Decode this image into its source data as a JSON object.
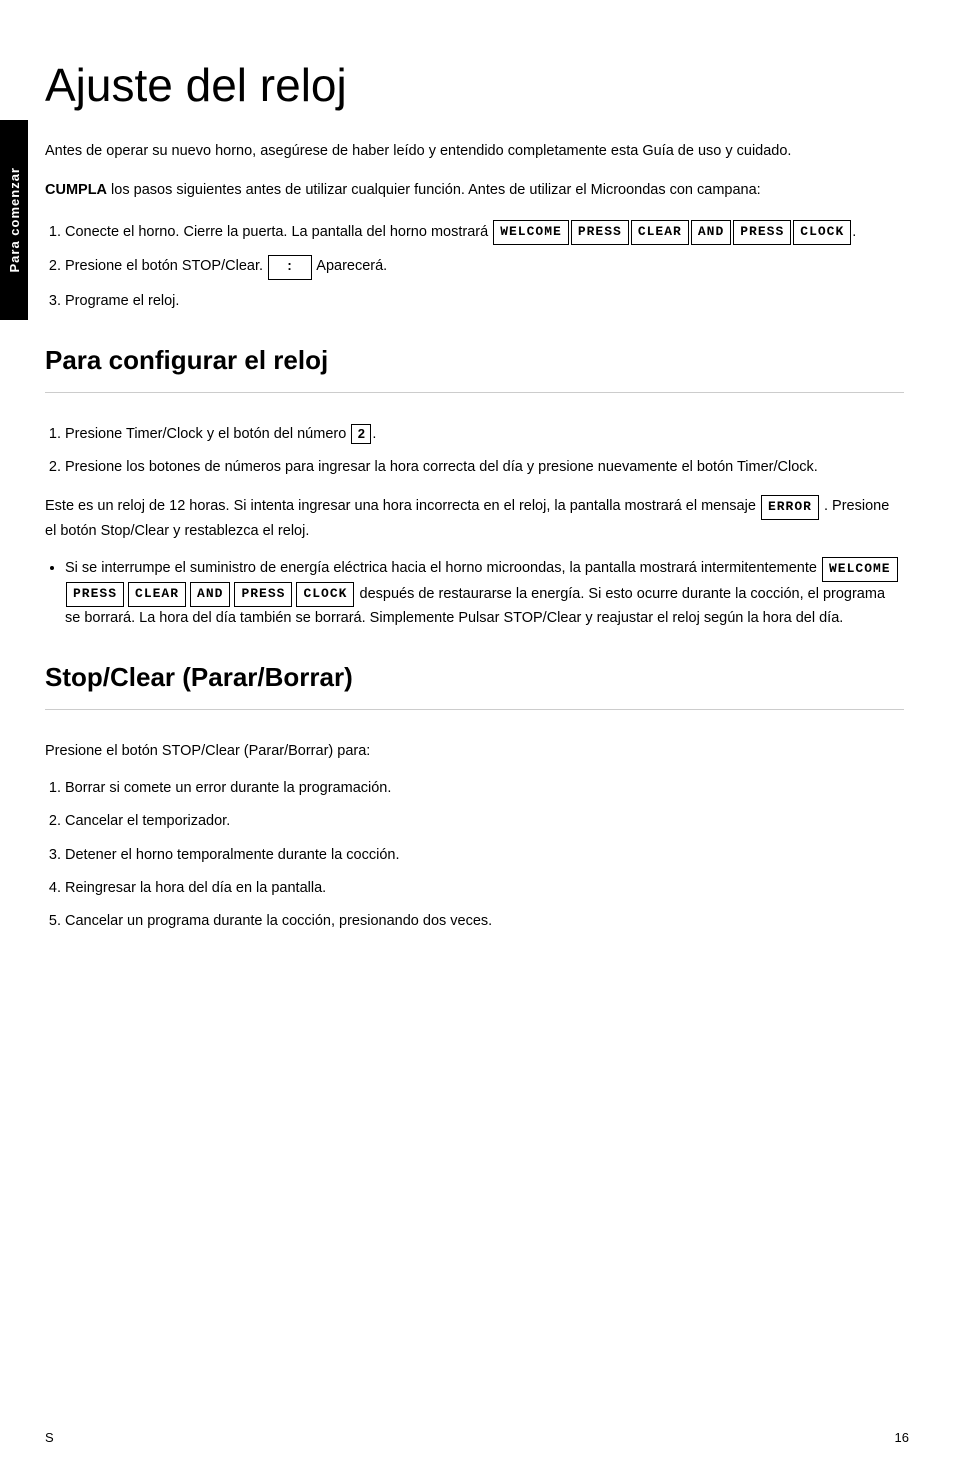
{
  "sidebar": {
    "label": "Para comenzar"
  },
  "page": {
    "title": "Ajuste del reloj",
    "footer_left": "S",
    "footer_center": "16"
  },
  "intro": {
    "paragraph1": "Antes de operar su nuevo horno, asegúrese de haber leído y entendido completamente esta Guía de uso y cuidado.",
    "bold": "CUMPLA",
    "paragraph2": " los pasos siguientes antes de utilizar cualquier función. Antes de utilizar el Microondas con campana:"
  },
  "steps": {
    "step1_prefix": "Conecte el horno. Cierre la puerta. La pantalla del horno mostrará ",
    "step1_suffix": ".",
    "step2_prefix": "Presione el botón STOP/Clear.",
    "step2_suffix": "Aparecerá.",
    "step3": "Programe el reloj."
  },
  "lcd_labels": {
    "welcome": "WELCOME",
    "press1": "PRESS",
    "clear": "CLEAR",
    "and": "AND",
    "press2": "PRESS",
    "clock": "CLOCK",
    "time": "  :  ",
    "error": "ERROR",
    "press_a": "PRESS",
    "clear_b": "CLEAR",
    "and_b": "AND",
    "press_b": "PRESS",
    "clock_b": "CLOCK"
  },
  "section_configurar": {
    "title": "Para configurar el reloj",
    "item1": "Presione Timer/Clock y el botón del número ",
    "item2": "Presione los botones de números para ingresar la hora correcta del día y presione nuevamente el botón Timer/Clock.",
    "body1": "Este es un reloj de 12 horas. Si intenta ingresar una hora incorrecta en el reloj, la pantalla mostrará el mensaje ",
    "body1_suffix": ". Presione el botón Stop/Clear y restablezca el reloj.",
    "bullet1_prefix": "Si se interrumpe el suministro de energía eléctrica hacia el horno microondas, la pantalla mostrará intermitentemente ",
    "bullet1_mid": " después de restaurarse la energía. Si esto ocurre durante la cocción, el programa se borrará. La hora del día también se borrará. Simplemente Pulsar STOP/Clear y reajustar el reloj según la hora del día."
  },
  "section_stopclear": {
    "title": "Stop/Clear (Parar/Borrar)",
    "intro": "Presione el botón STOP/Clear (Parar/Borrar) para:",
    "item1": "Borrar si comete un error durante la programación.",
    "item2": "Cancelar el temporizador.",
    "item3": "Detener el horno temporalmente durante la cocción.",
    "item4": "Reingresar la hora del día en la pantalla.",
    "item5": "Cancelar un programa durante la cocción, presionando dos veces."
  }
}
